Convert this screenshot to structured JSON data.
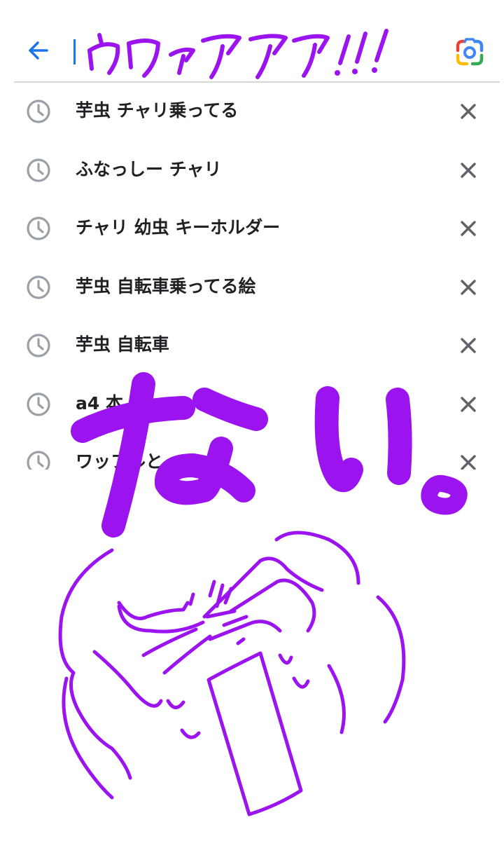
{
  "header": {
    "back_icon": "arrow-left-icon",
    "lens_icon": "google-lens-camera-icon",
    "search_value": ""
  },
  "history": {
    "clock_icon": "history-clock-icon",
    "remove_icon": "close-x-icon",
    "items": [
      {
        "label": "芋虫 チャリ乗ってる"
      },
      {
        "label": "ふなっしー チャリ"
      },
      {
        "label": "チャリ 幼虫 キーホルダー"
      },
      {
        "label": "芋虫 自転車乗ってる絵"
      },
      {
        "label": "芋虫 自転車"
      },
      {
        "label": "a4 本"
      },
      {
        "label": "ワッフルと"
      }
    ]
  },
  "drawing": {
    "handwriting_top": "ウワァアアア!!!",
    "handwriting_big": "ない。",
    "ink_color": "#9b14f0"
  },
  "colors": {
    "accent": "#1a73e8",
    "text": "#202124",
    "icon_gray": "#9aa0a6",
    "close_gray": "#5f6368"
  }
}
